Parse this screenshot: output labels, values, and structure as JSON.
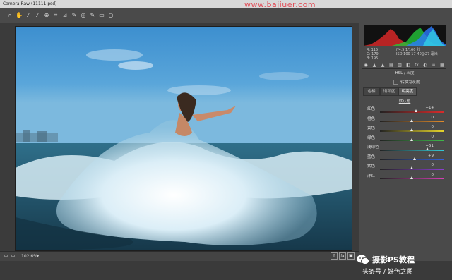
{
  "window": {
    "title": "Camera Raw (11111.psd)",
    "watermark": "www.bajiuer.com"
  },
  "toolbar": {
    "tools": [
      "zoom-icon",
      "hand-icon",
      "white-balance-icon",
      "color-sampler-icon",
      "target-adjust-icon",
      "crop-icon",
      "straighten-icon",
      "spot-removal-icon",
      "red-eye-icon",
      "brush-icon",
      "graduated-filter-icon",
      "radial-filter-icon"
    ]
  },
  "readout": {
    "r": "R: 115",
    "g": "G: 179",
    "b": "B: 195",
    "exposure": "f/4.5   1/160 秒",
    "iso": "ISO 100    17-40@27 毫米"
  },
  "panel": {
    "section_title": "HSL / 灰度",
    "grayscale_checkbox": "转换为灰度",
    "subtabs": [
      "色相",
      "饱和度",
      "明亮度"
    ],
    "active_subtab": "明亮度",
    "defaults_link": "默认值",
    "sliders": [
      {
        "label": "红色",
        "value": "+14",
        "pos": 0.57,
        "color": "red"
      },
      {
        "label": "橙色",
        "value": "0",
        "pos": 0.5,
        "color": "orange"
      },
      {
        "label": "黄色",
        "value": "0",
        "pos": 0.5,
        "color": "yellow"
      },
      {
        "label": "绿色",
        "value": "0",
        "pos": 0.5,
        "color": "green"
      },
      {
        "label": "浅绿色",
        "value": "+51",
        "pos": 0.75,
        "color": "aqua"
      },
      {
        "label": "蓝色",
        "value": "+9",
        "pos": 0.55,
        "color": "blue"
      },
      {
        "label": "紫色",
        "value": "0",
        "pos": 0.5,
        "color": "purple"
      },
      {
        "label": "洋红",
        "value": "0",
        "pos": 0.5,
        "color": "magenta"
      }
    ]
  },
  "bottombar": {
    "zoom": "102.6%"
  },
  "logo": {
    "line1": "摄影PS教程",
    "line2": "头条号 / 好色之图"
  },
  "colors": {
    "accent_watermark": "#e0505a",
    "panel_bg": "#4a4a4a",
    "sky_top": "#3d8fcf",
    "sea": "#1e4f63"
  }
}
